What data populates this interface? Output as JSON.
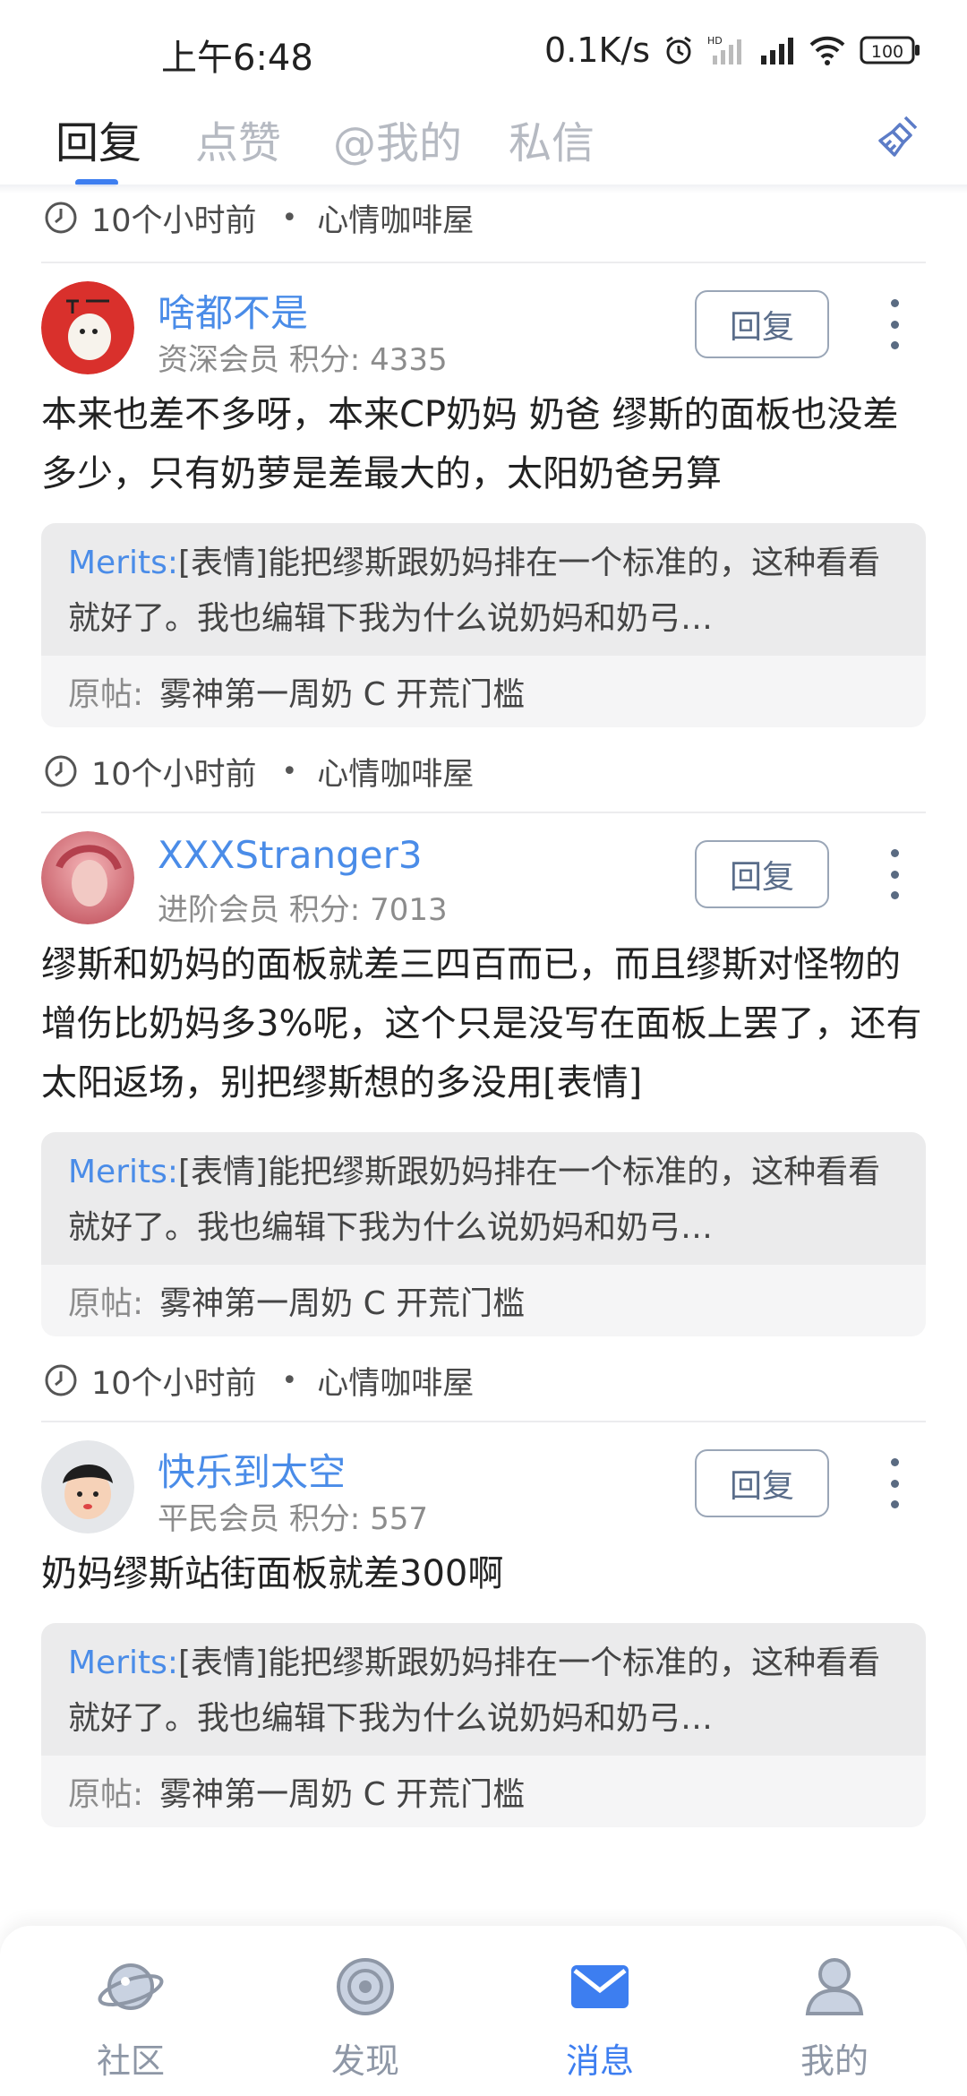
{
  "status_bar": {
    "time": "上午6:48",
    "speed": "0.1K/s",
    "battery": "100",
    "icons": [
      "alarm-icon",
      "hd-signal-icon",
      "signal-icon",
      "wifi-icon",
      "battery-icon"
    ]
  },
  "tabs": [
    {
      "label": "回复",
      "active": true
    },
    {
      "label": "点赞",
      "active": false
    },
    {
      "label": "@我的",
      "active": false
    },
    {
      "label": "私信",
      "active": false
    }
  ],
  "top_meta": {
    "time": "10个小时前",
    "forum": "心情咖啡屋"
  },
  "replies": [
    {
      "user": "啥都不是",
      "level": "资深会员",
      "points_label": "积分: 4335",
      "reply_label": "回复",
      "content": "本来也差不多呀，本来CP奶妈 奶爸 缪斯的面板也没差多少，只有奶萝是差最大的，太阳奶爸另算",
      "quote_user": "Merits:",
      "quote_text": "[表情]能把缪斯跟奶妈排在一个标准的，这种看看就好了。我也编辑下我为什么说奶妈和奶弓…",
      "orig_label": "原帖:",
      "orig_title": "雾神第一周奶 C 开荒门槛",
      "time": "10个小时前",
      "forum": "心情咖啡屋"
    },
    {
      "user": "XXXStranger3",
      "level": "进阶会员",
      "points_label": "积分: 7013",
      "reply_label": "回复",
      "content": "缪斯和奶妈的面板就差三四百而已，而且缪斯对怪物的增伤比奶妈多3%呢，这个只是没写在面板上罢了，还有太阳返场，别把缪斯想的多没用[表情]",
      "quote_user": "Merits:",
      "quote_text": "[表情]能把缪斯跟奶妈排在一个标准的，这种看看就好了。我也编辑下我为什么说奶妈和奶弓…",
      "orig_label": "原帖:",
      "orig_title": "雾神第一周奶 C 开荒门槛",
      "time": "10个小时前",
      "forum": "心情咖啡屋"
    },
    {
      "user": "快乐到太空",
      "level": "平民会员",
      "points_label": "积分: 557",
      "reply_label": "回复",
      "content": "奶妈缪斯站街面板就差300啊",
      "quote_user": "Merits:",
      "quote_text": "[表情]能把缪斯跟奶妈排在一个标准的，这种看看就好了。我也编辑下我为什么说奶妈和奶弓…",
      "orig_label": "原帖:",
      "orig_title": "雾神第一周奶 C 开荒门槛"
    }
  ],
  "nav": [
    {
      "label": "社区",
      "icon": "planet-icon",
      "active": false
    },
    {
      "label": "发现",
      "icon": "discover-icon",
      "active": false
    },
    {
      "label": "消息",
      "icon": "message-icon",
      "active": true
    },
    {
      "label": "我的",
      "icon": "profile-icon",
      "active": false
    }
  ],
  "colors": {
    "accent": "#3d7ef0",
    "username": "#4a8ce8",
    "quote_bg": "#ebebec"
  }
}
